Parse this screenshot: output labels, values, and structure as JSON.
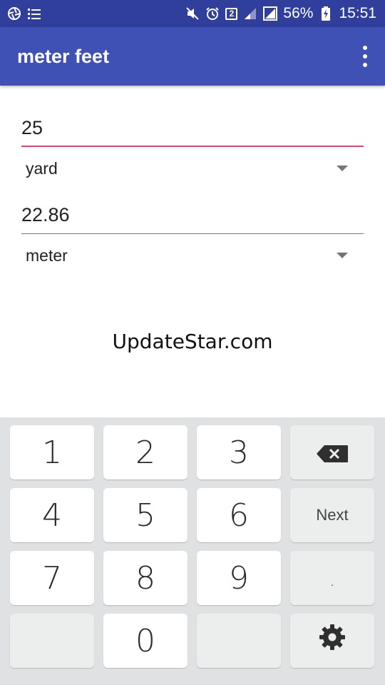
{
  "status_bar": {
    "battery_percent": "56%",
    "time": "15:51",
    "sim_badge": "2",
    "icons": [
      "aperture-icon",
      "list-icon",
      "mute-icon",
      "alarm-icon",
      "sim-badge-icon",
      "signal-icon",
      "signal-icon",
      "battery-charging-icon"
    ]
  },
  "app_bar": {
    "title": "meter feet",
    "menu_icon": "overflow-menu-icon"
  },
  "converter": {
    "input_value": "25",
    "input_unit": "yard",
    "output_value": "22.86",
    "output_unit": "meter"
  },
  "watermark": "UpdateStar.com",
  "keyboard": {
    "keys": [
      "1",
      "2",
      "3",
      "4",
      "5",
      "6",
      "7",
      "8",
      "9",
      "0"
    ],
    "next_label": "Next",
    "dot_label": ".",
    "backspace_icon": "backspace-icon",
    "settings_icon": "gear-icon"
  },
  "colors": {
    "status_bar": "#2f3f9b",
    "app_bar": "#3f51b5",
    "accent": "#e2457a",
    "keyboard_bg": "#dfe1e3"
  }
}
